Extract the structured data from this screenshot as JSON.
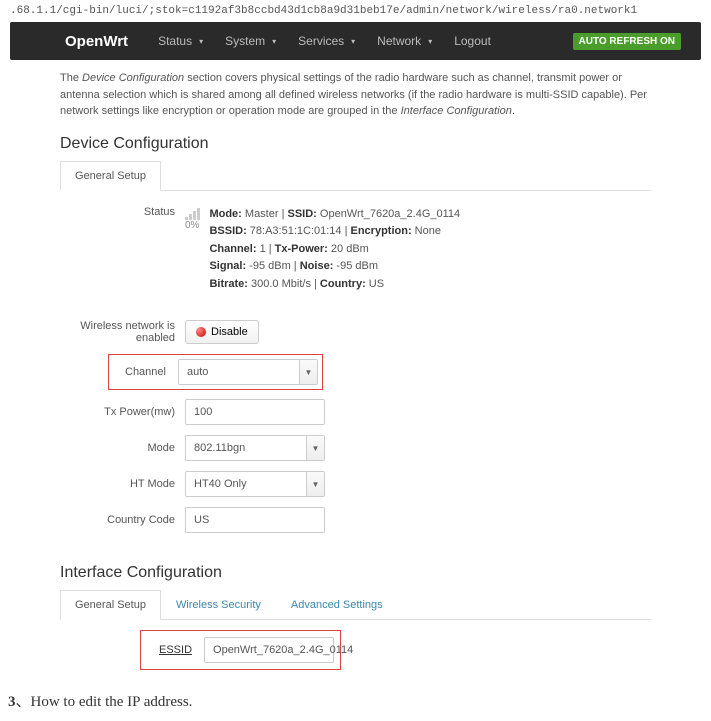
{
  "url": ".68.1.1/cgi-bin/luci/;stok=c1192af3b8ccbd43d1cb8a9d31beb17e/admin/network/wireless/ra0.network1",
  "brand": "OpenWrt",
  "nav": {
    "status": "Status",
    "system": "System",
    "services": "Services",
    "network": "Network",
    "logout": "Logout"
  },
  "auto_refresh": "AUTO REFRESH ON",
  "description": {
    "p1a": "The ",
    "p1em": "Device Configuration",
    "p1b": " section covers physical settings of the radio hardware such as channel, transmit power or antenna selection which is shared among all defined wireless networks (if the radio hardware is multi-SSID capable). Per network settings like encryption or operation mode are grouped in the ",
    "p1em2": "Interface Configuration",
    "p1c": "."
  },
  "device_config": {
    "title": "Device Configuration",
    "tab_general": "General Setup",
    "status_label": "Status",
    "pct": "0%",
    "status": {
      "mode_k": "Mode:",
      "mode_v": " Master | ",
      "ssid_k": "SSID:",
      "ssid_v": " OpenWrt_7620a_2.4G_0114",
      "bssid_k": "BSSID:",
      "bssid_v": " 78:A3:51:1C:01:14 | ",
      "enc_k": "Encryption:",
      "enc_v": " None",
      "chan_k": "Channel:",
      "chan_v": " 1 | ",
      "txp_k": "Tx-Power:",
      "txp_v": " 20 dBm",
      "sig_k": "Signal:",
      "sig_v": " -95 dBm | ",
      "noise_k": "Noise:",
      "noise_v": " -95 dBm",
      "bitrate_k": "Bitrate:",
      "bitrate_v": " 300.0 Mbit/s | ",
      "country_k": "Country:",
      "country_v": " US"
    },
    "enabled_label": "Wireless network is enabled",
    "disable_btn": "Disable",
    "channel_label": "Channel",
    "channel_value": "auto",
    "txpower_label": "Tx Power(mw)",
    "txpower_value": "100",
    "mode_label": "Mode",
    "mode_value": "802.11bgn",
    "htmode_label": "HT Mode",
    "htmode_value": "HT40 Only",
    "country_label": "Country Code",
    "country_value": "US"
  },
  "iface_config": {
    "title": "Interface Configuration",
    "tab_general": "General Setup",
    "tab_security": "Wireless Security",
    "tab_advanced": "Advanced Settings",
    "essid_label": "ESSID",
    "essid_value": "OpenWrt_7620a_2.4G_0114"
  },
  "footer": {
    "num": "3",
    "sep": "、",
    "text": "How to edit the IP address."
  }
}
